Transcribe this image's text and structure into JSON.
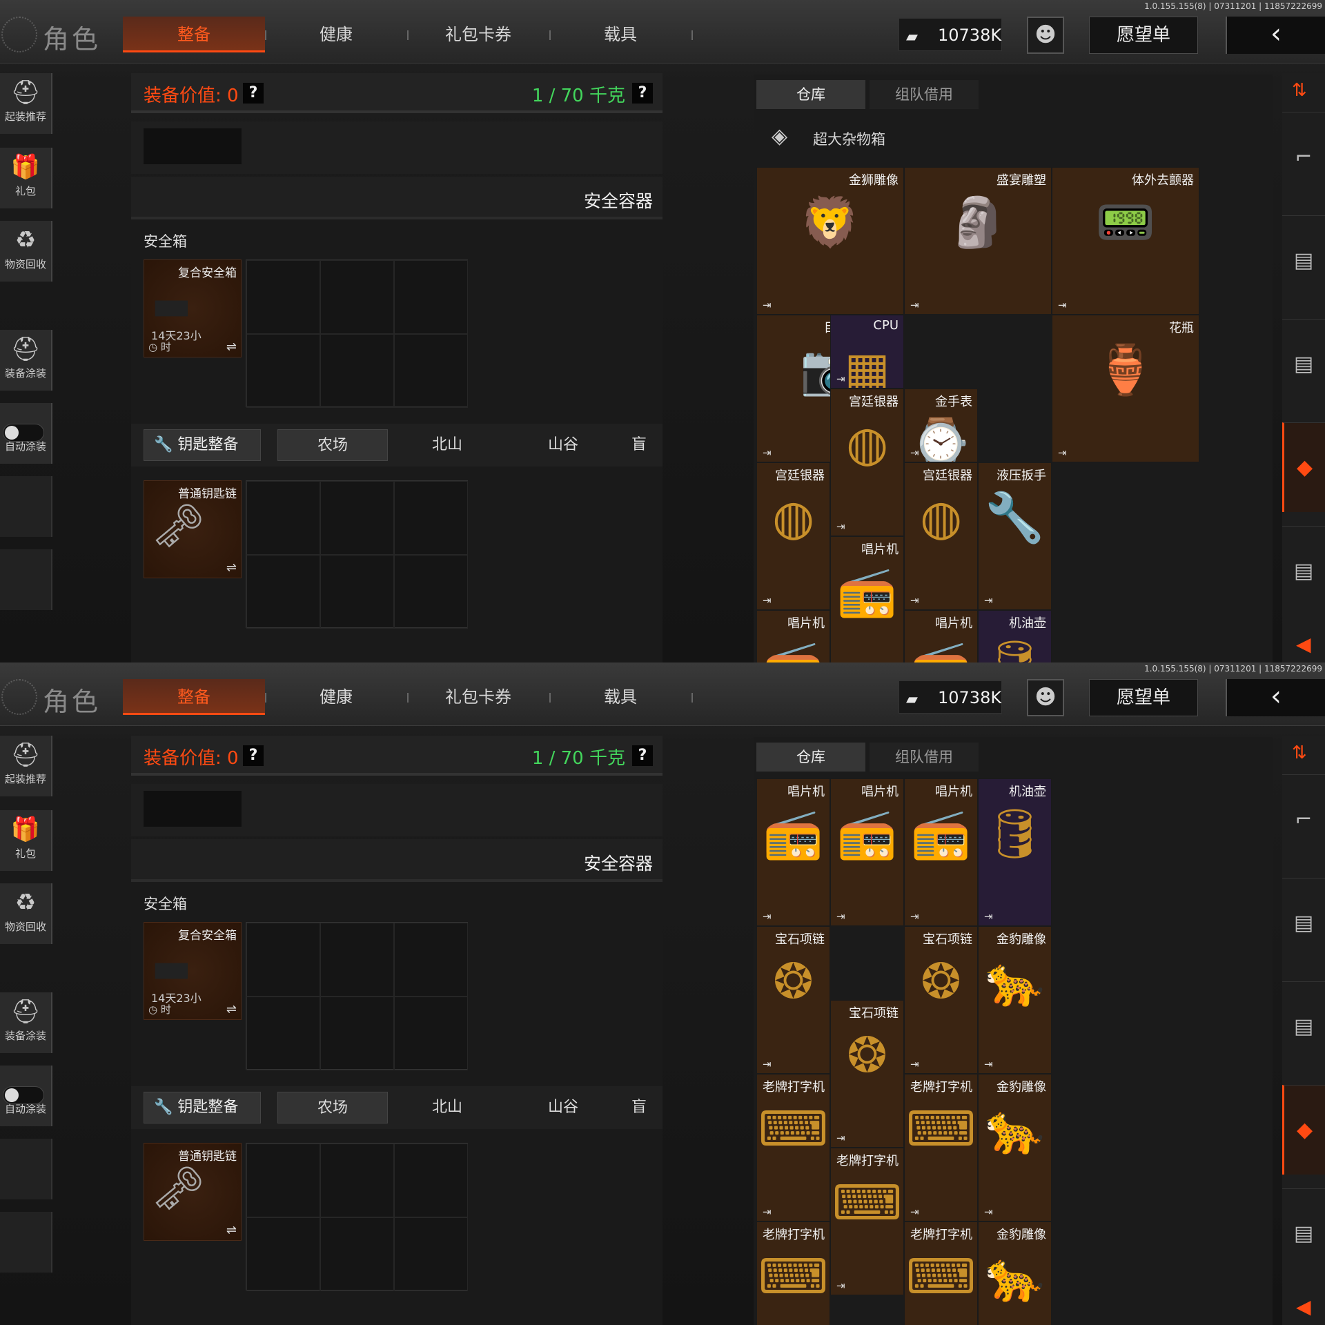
{
  "version": "1.0.155.155(8) | 07311201 | 11857222699",
  "header": {
    "title": "角色",
    "tabs": [
      "整备",
      "健康",
      "礼包卡券",
      "载具"
    ],
    "currency": "10738K",
    "wishlist": "愿望单",
    "back": "‹"
  },
  "sidebar": [
    "起装推荐",
    "礼包",
    "物资回收",
    "装备涂装",
    "自动涂装"
  ],
  "equipment": {
    "value_label": "装备价值: 0",
    "weight": "1 / 70 千克",
    "help": "?",
    "container_title": "安全容器",
    "safebox_title": "安全箱",
    "safebox_name": "复合安全箱",
    "safebox_time_a": "14天23小",
    "safebox_time_b": "时",
    "key_button": "钥匙整备",
    "maps": [
      "农场",
      "北山",
      "山谷",
      "盲"
    ],
    "keychain_name": "普通钥匙链",
    "swap": "⇌"
  },
  "warehouse": {
    "tabs": [
      "仓库",
      "组队借用"
    ],
    "box_title": "超大杂物箱",
    "exit": "⇥",
    "items1": [
      "金狮雕像",
      "盛宴雕塑",
      "体外去颤器",
      "目标定位模块",
      "CPU",
      "花瓶",
      "宫廷银器",
      "金手表",
      "宫廷银器",
      "宫廷银器",
      "液压扳手",
      "唱片机",
      "唱片机",
      "唱片机",
      "机油壶"
    ],
    "items2": [
      "唱片机",
      "唱片机",
      "机油壶",
      "唱片机",
      "宝石项链",
      "宝石项链",
      "金豹雕像",
      "宝石项链",
      "老牌打字机",
      "老牌打字机",
      "金豹雕像",
      "老牌打字机",
      "老牌打字机",
      "老牌打字机",
      "金豹雕像"
    ]
  }
}
